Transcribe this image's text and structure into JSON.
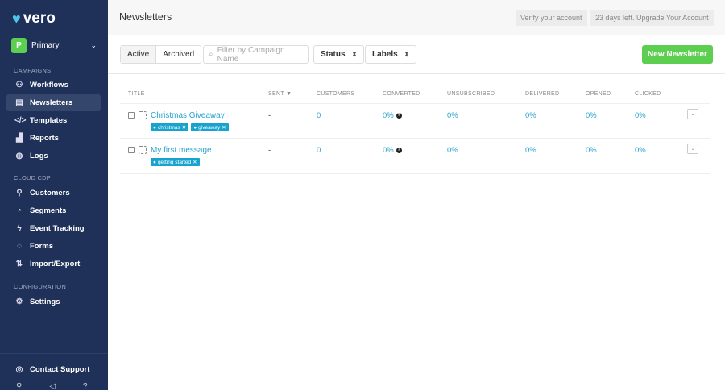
{
  "sidebar": {
    "logo": "vero",
    "account": {
      "initial": "P",
      "name": "Primary"
    },
    "sections": {
      "campaigns": "CAMPAIGNS",
      "cdp": "CLOUD CDP",
      "config": "CONFIGURATION"
    },
    "items": [
      {
        "label": "Workflows",
        "icon": "workflow-icon"
      },
      {
        "label": "Newsletters",
        "icon": "newsletter-icon",
        "active": true
      },
      {
        "label": "Templates",
        "icon": "code-icon"
      },
      {
        "label": "Reports",
        "icon": "chart-icon"
      },
      {
        "label": "Logs",
        "icon": "globe-icon"
      },
      {
        "label": "Customers",
        "icon": "user-icon"
      },
      {
        "label": "Segments",
        "icon": "pie-icon"
      },
      {
        "label": "Event Tracking",
        "icon": "bolt-icon"
      },
      {
        "label": "Forms",
        "icon": "chat-icon"
      },
      {
        "label": "Import/Export",
        "icon": "import-export-icon"
      },
      {
        "label": "Settings",
        "icon": "gear-icon"
      }
    ],
    "support": "Contact Support"
  },
  "header": {
    "title": "Newsletters",
    "verify": "Verify your account",
    "upgrade": "23 days left. Upgrade Your Account"
  },
  "toolbar": {
    "active": "Active",
    "archived": "Archived",
    "filter_placeholder": "Filter by Campaign Name",
    "status": "Status",
    "labels": "Labels",
    "new": "New Newsletter"
  },
  "table": {
    "headers": [
      "TITLE",
      "SENT ▼",
      "CUSTOMERS",
      "CONVERTED",
      "UNSUBSCRIBED",
      "DELIVERED",
      "OPENED",
      "CLICKED"
    ],
    "rows": [
      {
        "title": "Christmas Giveaway",
        "tags": [
          "christmas",
          "giveaway"
        ],
        "sent": "-",
        "customers": "0",
        "converted": "0%",
        "unsubscribed": "0%",
        "delivered": "0%",
        "opened": "0%",
        "clicked": "0%"
      },
      {
        "title": "My first message",
        "tags": [
          "getting started"
        ],
        "sent": "-",
        "customers": "0",
        "converted": "0%",
        "unsubscribed": "0%",
        "delivered": "0%",
        "opened": "0%",
        "clicked": "0%"
      }
    ]
  },
  "colors": {
    "sidebar": "#1f3159",
    "accent": "#2aa3cc",
    "primary_button": "#5ccf50"
  }
}
